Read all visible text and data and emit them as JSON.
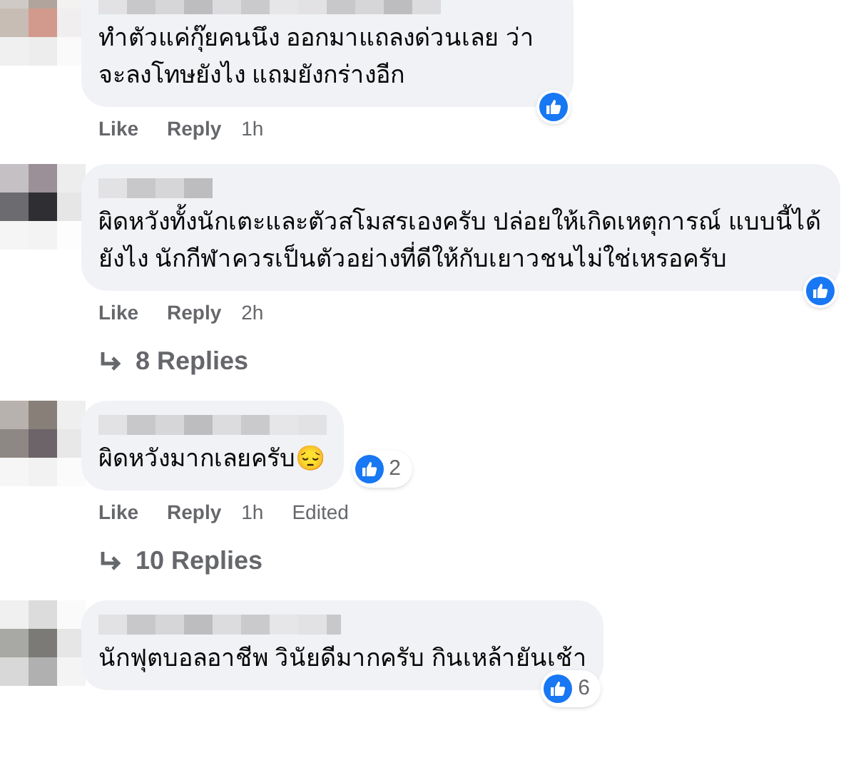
{
  "comments": [
    {
      "text": "ทำตัวแค่กุ๊ยคนนึง ออกมาแถลงด่วนเลย ว่าจะลงโทษยังไง แถมยังกร่างอีก",
      "reaction": {
        "kind": "overlap"
      },
      "actions": {
        "like": "Like",
        "reply": "Reply",
        "time": "1h"
      }
    },
    {
      "text": "ผิดหวังทั้งนักเตะและตัวสโมสรเองครับ ปล่อยให้เกิดเหตุการณ์ แบบนี้ได้ยังไง นักกีฬาควรเป็นตัวอย่างที่ดีให้กับเยาวชนไม่ใช่เหรอครับ",
      "reaction": {
        "kind": "overlap"
      },
      "actions": {
        "like": "Like",
        "reply": "Reply",
        "time": "2h"
      },
      "replies": "8 Replies"
    },
    {
      "text": "ผิดหวังมากเลยครับ😔",
      "reaction": {
        "kind": "outside",
        "count": "2"
      },
      "actions": {
        "like": "Like",
        "reply": "Reply",
        "time": "1h",
        "edited": "Edited"
      },
      "replies": "10 Replies"
    },
    {
      "text": "นักฟุตบอลอาชีพ วินัยดีมากครับ กินเหล้ายันเช้า",
      "reaction": {
        "kind": "overlap",
        "count": "6"
      }
    }
  ]
}
